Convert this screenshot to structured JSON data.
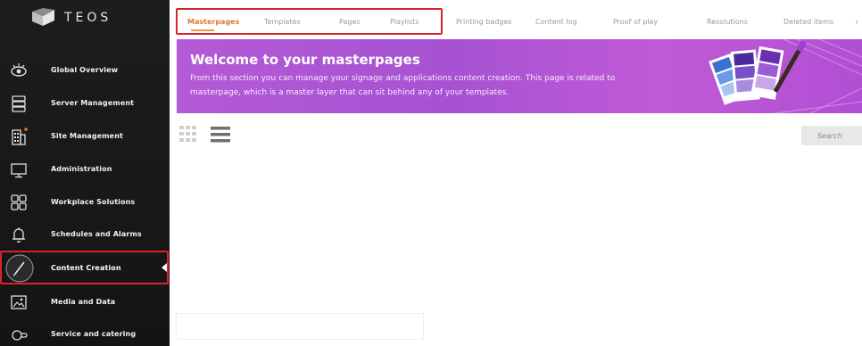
{
  "brand": {
    "name": "TEOS"
  },
  "sidebar": {
    "items": [
      {
        "label": "Global Overview",
        "icon": "eye-icon"
      },
      {
        "label": "Server Management",
        "icon": "server-icon"
      },
      {
        "label": "Site Management",
        "icon": "building-icon"
      },
      {
        "label": "Administration",
        "icon": "monitor-icon"
      },
      {
        "label": "Workplace Solutions",
        "icon": "grid-squares-icon"
      },
      {
        "label": "Schedules and Alarms",
        "icon": "bell-icon"
      },
      {
        "label": "Content Creation",
        "icon": "pen-icon",
        "active": true
      },
      {
        "label": "Media and Data",
        "icon": "image-icon"
      },
      {
        "label": "Service and catering",
        "icon": "service-icon"
      }
    ]
  },
  "tabs": [
    {
      "label": "Masterpages",
      "active": true
    },
    {
      "label": "Templates"
    },
    {
      "label": "Pages"
    },
    {
      "label": "Playlists"
    },
    {
      "label": "Printing badges"
    },
    {
      "label": "Content log"
    },
    {
      "label": "Proof of play"
    },
    {
      "label": "Resolutions"
    },
    {
      "label": "Deleted items"
    }
  ],
  "banner": {
    "title": "Welcome to your masterpages",
    "text": "From this section you can manage your signage and applications content creation. This page is related to masterpage, which is a master layer that can sit behind any of your templates."
  },
  "search": {
    "placeholder": "Search"
  },
  "colors": {
    "accent": "#e07a2f",
    "highlight_frame": "#d8232a",
    "banner": "#b45ad6",
    "sidebar_bg": "#1a1a1a"
  }
}
